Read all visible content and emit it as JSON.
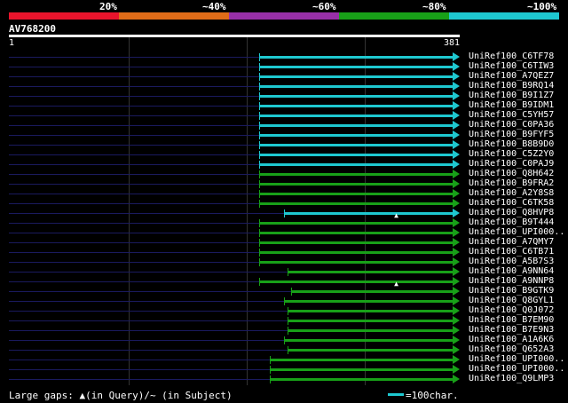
{
  "legend": {
    "labels": [
      "20%",
      "~40%",
      "~60%",
      "~80%",
      "~100%"
    ],
    "colors": [
      "#e8142c",
      "#e06c18",
      "#9830a8",
      "#18a018",
      "#1ec8d0"
    ]
  },
  "query": {
    "id": "AV768200",
    "start": "1",
    "end": "381",
    "length": 381
  },
  "hits": [
    {
      "label": "UniRef100_C6TF78",
      "start": 212,
      "color": "#1ec8d0"
    },
    {
      "label": "UniRef100_C6TIW3",
      "start": 212,
      "color": "#1ec8d0"
    },
    {
      "label": "UniRef100_A7QEZ7",
      "start": 212,
      "color": "#1ec8d0"
    },
    {
      "label": "UniRef100_B9RQ14",
      "start": 212,
      "color": "#1ec8d0"
    },
    {
      "label": "UniRef100_B9I1Z7",
      "start": 212,
      "color": "#1ec8d0"
    },
    {
      "label": "UniRef100_B9IDM1",
      "start": 212,
      "color": "#1ec8d0"
    },
    {
      "label": "UniRef100_C5YH57",
      "start": 212,
      "color": "#1ec8d0"
    },
    {
      "label": "UniRef100_C0PA36",
      "start": 212,
      "color": "#1ec8d0"
    },
    {
      "label": "UniRef100_B9FYF5",
      "start": 212,
      "color": "#1ec8d0"
    },
    {
      "label": "UniRef100_B8B9D0",
      "start": 212,
      "color": "#1ec8d0"
    },
    {
      "label": "UniRef100_C5Z2Y0",
      "start": 212,
      "color": "#1ec8d0"
    },
    {
      "label": "UniRef100_C0PAJ9",
      "start": 212,
      "color": "#1ec8d0"
    },
    {
      "label": "UniRef100_Q8H642",
      "start": 212,
      "color": "#18a018"
    },
    {
      "label": "UniRef100_B9FRA2",
      "start": 212,
      "color": "#18a018"
    },
    {
      "label": "UniRef100_A2Y8S8",
      "start": 212,
      "color": "#18a018"
    },
    {
      "label": "UniRef100_C6TK58",
      "start": 212,
      "color": "#18a018"
    },
    {
      "label": "UniRef100_Q8HVP8",
      "start": 233,
      "color": "#1ec8d0",
      "gap_at": 328
    },
    {
      "label": "UniRef100_B9T444",
      "start": 212,
      "color": "#18a018"
    },
    {
      "label": "UniRef100_UPI000..",
      "start": 212,
      "color": "#18a018"
    },
    {
      "label": "UniRef100_A7QMY7",
      "start": 212,
      "color": "#18a018"
    },
    {
      "label": "UniRef100_C6TB71",
      "start": 212,
      "color": "#18a018"
    },
    {
      "label": "UniRef100_A5B7S3",
      "start": 212,
      "color": "#18a018"
    },
    {
      "label": "UniRef100_A9NN64",
      "start": 236,
      "color": "#18a018"
    },
    {
      "label": "UniRef100_A9NNP8",
      "start": 212,
      "color": "#18a018",
      "gap_at": 328
    },
    {
      "label": "UniRef100_B9GTK9",
      "start": 239,
      "color": "#18a018"
    },
    {
      "label": "UniRef100_Q8GYL1",
      "start": 233,
      "color": "#18a018"
    },
    {
      "label": "UniRef100_Q0J072",
      "start": 236,
      "color": "#18a018"
    },
    {
      "label": "UniRef100_B7EM90",
      "start": 236,
      "color": "#18a018"
    },
    {
      "label": "UniRef100_B7E9N3",
      "start": 236,
      "color": "#18a018"
    },
    {
      "label": "UniRef100_A1A6K6",
      "start": 233,
      "color": "#18a018"
    },
    {
      "label": "UniRef100_Q652A3",
      "start": 236,
      "color": "#18a018"
    },
    {
      "label": "UniRef100_UPI000..",
      "start": 221,
      "color": "#18a018"
    },
    {
      "label": "UniRef100_UPI000..",
      "start": 221,
      "color": "#18a018"
    },
    {
      "label": "UniRef100_Q9LMP3",
      "start": 221,
      "color": "#18a018"
    }
  ],
  "footer": {
    "gaps_text": "Large gaps: ▲(in Query)/~ (in Subject)",
    "scale_text": "=100char."
  }
}
